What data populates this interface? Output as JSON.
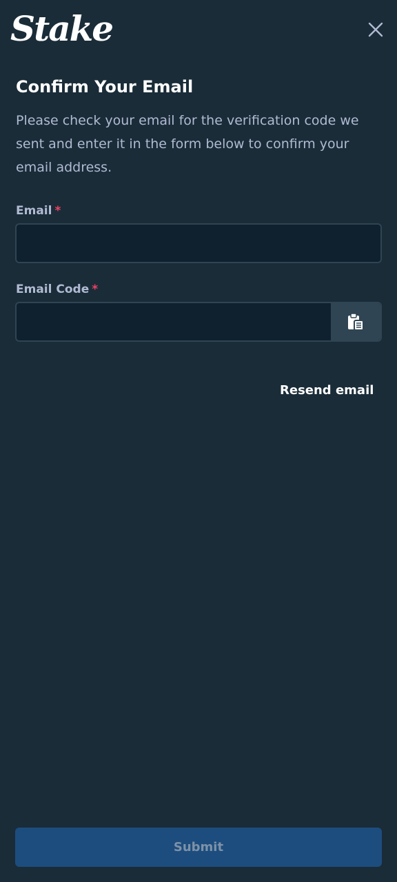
{
  "brand": {
    "logo_text": "Stake"
  },
  "header": {
    "close_icon": "close-icon"
  },
  "form": {
    "title": "Confirm Your Email",
    "description": "Please check your email for the verification code we sent and enter it in the form below to confirm your email address.",
    "email": {
      "label": "Email",
      "required_mark": "*",
      "value": ""
    },
    "email_code": {
      "label": "Email Code",
      "required_mark": "*",
      "value": "",
      "paste_icon": "clipboard-icon"
    },
    "resend_label": "Resend email",
    "submit_label": "Submit"
  },
  "colors": {
    "background": "#1a2c38",
    "input_background": "#0f212e",
    "input_border": "#2f4553",
    "muted_text": "#b1bad3",
    "required": "#ed4163",
    "submit_background": "#1d4d7e",
    "submit_text": "#7d92a8"
  }
}
